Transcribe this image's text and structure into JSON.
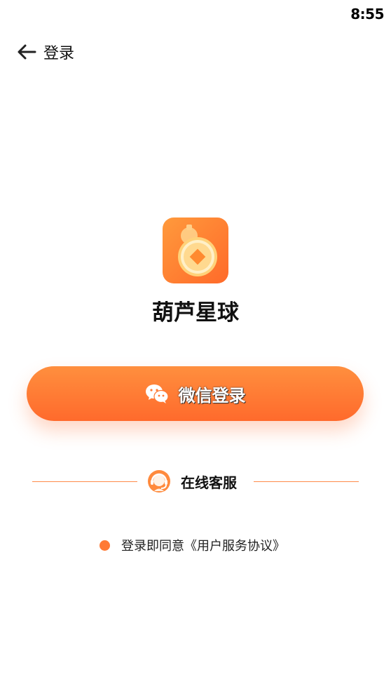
{
  "status_bar": {
    "time": "8:55"
  },
  "header": {
    "title": "登录",
    "back_icon": "arrow-left-icon"
  },
  "app": {
    "name": "葫芦星球",
    "logo_icon": "gourd-coin-icon"
  },
  "login": {
    "wechat_label": "微信登录",
    "wechat_icon": "wechat-icon"
  },
  "service": {
    "label": "在线客服",
    "icon": "customer-service-icon"
  },
  "agreement": {
    "prefix": "登录即同意",
    "link": "《用户服务协议》"
  },
  "colors": {
    "accent": "#ff7a35",
    "accent_light": "#ff9a3c",
    "text": "#111111"
  }
}
